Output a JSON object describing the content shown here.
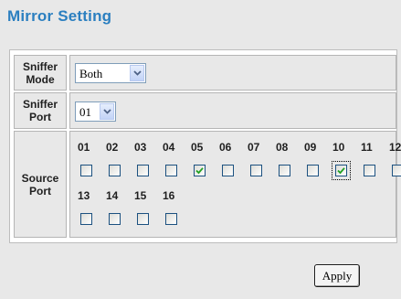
{
  "title": "Mirror Setting",
  "sniffer_mode": {
    "label_line1": "Sniffer",
    "label_line2": "Mode",
    "value": "Both"
  },
  "sniffer_port": {
    "label_line1": "Sniffer",
    "label_line2": "Port",
    "value": "01"
  },
  "source_port": {
    "label_line1": "Source",
    "label_line2": "Port",
    "ports": [
      {
        "label": "01",
        "checked": false
      },
      {
        "label": "02",
        "checked": false
      },
      {
        "label": "03",
        "checked": false
      },
      {
        "label": "04",
        "checked": false
      },
      {
        "label": "05",
        "checked": true
      },
      {
        "label": "06",
        "checked": false
      },
      {
        "label": "07",
        "checked": false
      },
      {
        "label": "08",
        "checked": false
      },
      {
        "label": "09",
        "checked": false
      },
      {
        "label": "10",
        "checked": true
      },
      {
        "label": "11",
        "checked": false
      },
      {
        "label": "12",
        "checked": false
      },
      {
        "label": "13",
        "checked": false
      },
      {
        "label": "14",
        "checked": false
      },
      {
        "label": "15",
        "checked": false
      },
      {
        "label": "16",
        "checked": false
      }
    ],
    "focused_port": "10"
  },
  "apply_label": "Apply",
  "colors": {
    "title": "#2b7fc0",
    "checkmark": "#21a121",
    "panel": "#e8e8e8"
  },
  "icons": {
    "dropdown": "chevron-down-icon",
    "check": "checkmark-icon"
  }
}
